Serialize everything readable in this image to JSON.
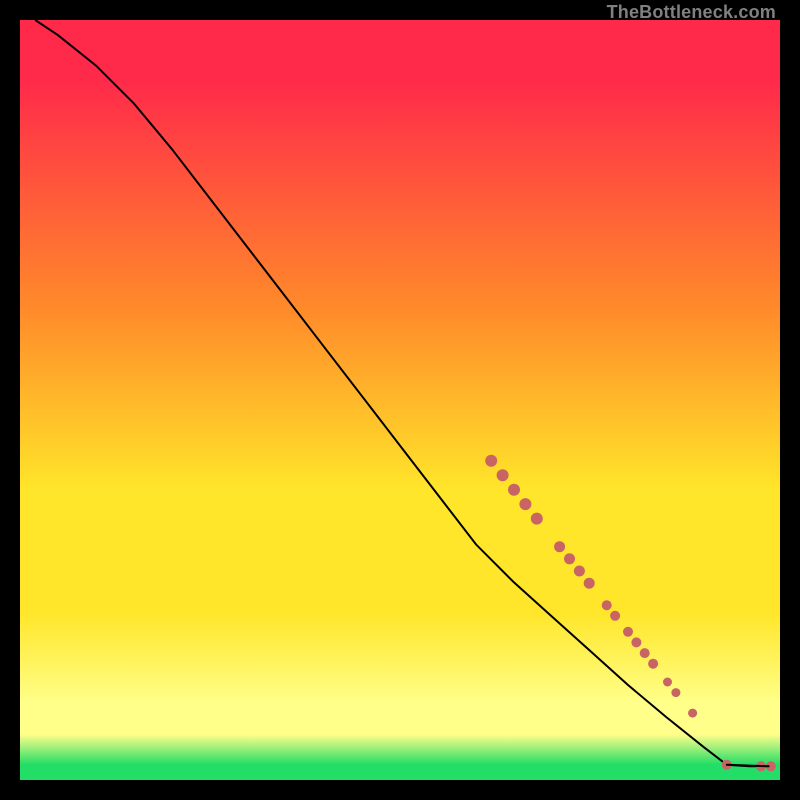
{
  "attribution": "TheBottleneck.com",
  "colors": {
    "red": "#ff2a4a",
    "orange": "#ff8a2a",
    "yellow": "#ffe62a",
    "pale_yellow": "#ffff8a",
    "green": "#22dd66",
    "dot": "#c86464",
    "line": "#000000"
  },
  "chart_data": {
    "type": "line",
    "title": "",
    "xlabel": "",
    "ylabel": "",
    "xlim": [
      0,
      100
    ],
    "ylim": [
      0,
      100
    ],
    "curve": [
      {
        "x": 2,
        "y": 100
      },
      {
        "x": 5,
        "y": 98
      },
      {
        "x": 10,
        "y": 94
      },
      {
        "x": 15,
        "y": 89
      },
      {
        "x": 20,
        "y": 83
      },
      {
        "x": 25,
        "y": 76.5
      },
      {
        "x": 30,
        "y": 70
      },
      {
        "x": 35,
        "y": 63.5
      },
      {
        "x": 40,
        "y": 57
      },
      {
        "x": 45,
        "y": 50.5
      },
      {
        "x": 50,
        "y": 44
      },
      {
        "x": 55,
        "y": 37.5
      },
      {
        "x": 60,
        "y": 31
      },
      {
        "x": 65,
        "y": 26
      },
      {
        "x": 70,
        "y": 21.5
      },
      {
        "x": 75,
        "y": 17
      },
      {
        "x": 80,
        "y": 12.5
      },
      {
        "x": 85,
        "y": 8.3
      },
      {
        "x": 90,
        "y": 4.3
      },
      {
        "x": 93,
        "y": 2.0
      },
      {
        "x": 96,
        "y": 1.8
      },
      {
        "x": 98.5,
        "y": 1.8
      }
    ],
    "dot_clusters": [
      {
        "x": 62,
        "y": 42,
        "r": 6
      },
      {
        "x": 63.5,
        "y": 40.1,
        "r": 6
      },
      {
        "x": 65,
        "y": 38.2,
        "r": 6
      },
      {
        "x": 66.5,
        "y": 36.3,
        "r": 6
      },
      {
        "x": 68,
        "y": 34.4,
        "r": 6
      },
      {
        "x": 71,
        "y": 30.7,
        "r": 5.5
      },
      {
        "x": 72.3,
        "y": 29.1,
        "r": 5.5
      },
      {
        "x": 73.6,
        "y": 27.5,
        "r": 5.5
      },
      {
        "x": 74.9,
        "y": 25.9,
        "r": 5.5
      },
      {
        "x": 77.2,
        "y": 23.0,
        "r": 5
      },
      {
        "x": 78.3,
        "y": 21.6,
        "r": 5
      },
      {
        "x": 80.0,
        "y": 19.5,
        "r": 5
      },
      {
        "x": 81.1,
        "y": 18.1,
        "r": 5
      },
      {
        "x": 82.2,
        "y": 16.7,
        "r": 5
      },
      {
        "x": 83.3,
        "y": 15.3,
        "r": 5
      },
      {
        "x": 85.2,
        "y": 12.9,
        "r": 4.5
      },
      {
        "x": 86.3,
        "y": 11.5,
        "r": 4.5
      },
      {
        "x": 88.5,
        "y": 8.8,
        "r": 4.5
      },
      {
        "x": 93.0,
        "y": 2.0,
        "r": 5
      },
      {
        "x": 97.5,
        "y": 1.8,
        "r": 5
      },
      {
        "x": 98.8,
        "y": 1.8,
        "r": 5
      }
    ]
  }
}
